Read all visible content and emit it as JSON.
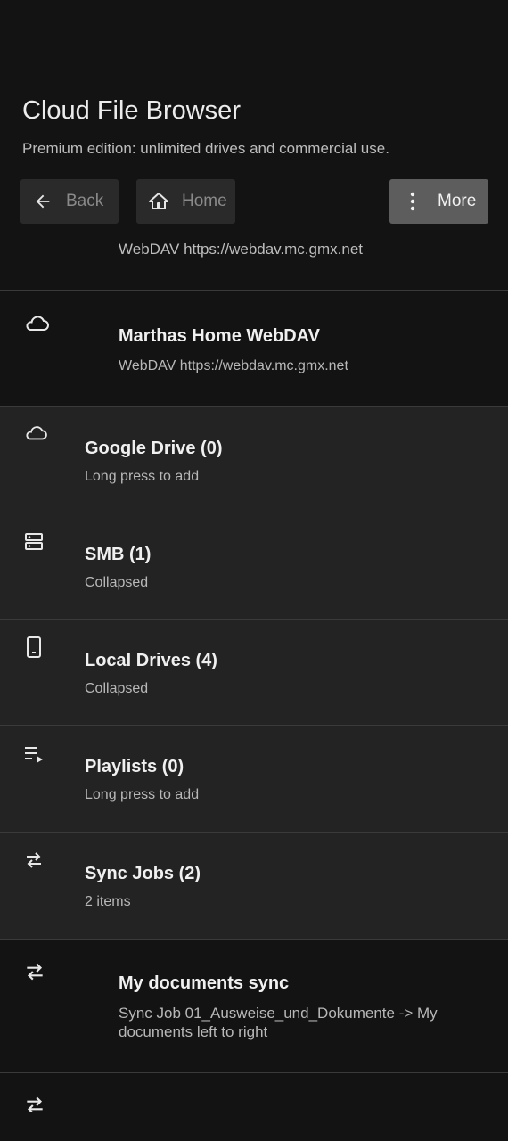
{
  "header": {
    "title": "Cloud File Browser",
    "subtitle": "Premium edition: unlimited drives and commercial use.",
    "buttons": {
      "back": "Back",
      "home": "Home",
      "more": "More"
    },
    "partial_entry_subtitle": "WebDAV  https://webdav.mc.gmx.net"
  },
  "rows": [
    {
      "title": "Marthas Home WebDAV",
      "subtitle": "WebDAV  https://webdav.mc.gmx.net",
      "icon": "cloud-icon"
    },
    {
      "title": "Google Drive (0)",
      "subtitle": "Long press to add",
      "icon": "cloud-icon"
    },
    {
      "title": "SMB (1)",
      "subtitle": "Collapsed",
      "icon": "server-icon"
    },
    {
      "title": "Local Drives (4)",
      "subtitle": "Collapsed",
      "icon": "phone-icon"
    },
    {
      "title": "Playlists (0)",
      "subtitle": "Long press to add",
      "icon": "playlist-icon"
    },
    {
      "title": "Sync Jobs (2)",
      "subtitle": "2 items",
      "icon": "sync-icon"
    },
    {
      "title": "My documents sync",
      "subtitle": "Sync Job  01_Ausweise_und_Dokumente -> My documents  left to right",
      "icon": "sync-icon"
    }
  ]
}
